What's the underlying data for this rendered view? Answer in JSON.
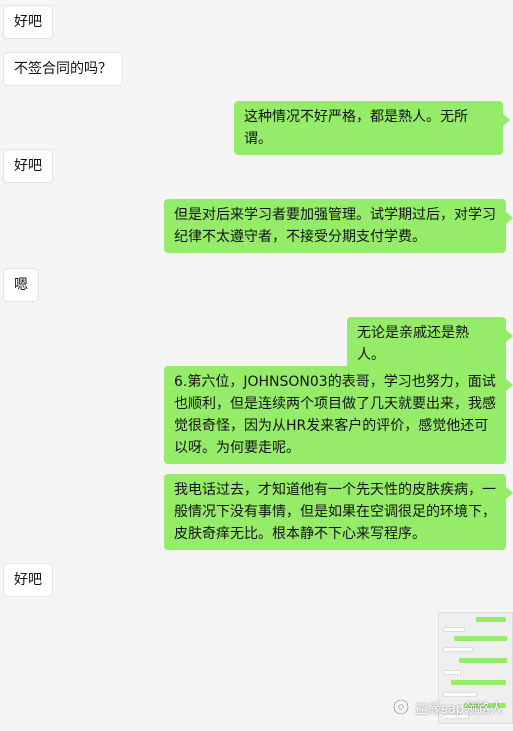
{
  "messages": [
    {
      "side": "left",
      "text": "好吧"
    },
    {
      "side": "left",
      "text": "不签合同的吗？"
    },
    {
      "side": "right",
      "text": "这种情况不好严格，都是熟人。无所谓。"
    },
    {
      "side": "left",
      "text": "好吧"
    },
    {
      "side": "right",
      "text": "但是对后来学习者要加强管理。试学期过后，对学习纪律不太遵守者，不接受分期支付学费。"
    },
    {
      "side": "left",
      "text": "嗯"
    },
    {
      "side": "right",
      "text": "无论是亲戚还是熟人。"
    },
    {
      "side": "right",
      "text": "6.第六位，JOHNSON03的表哥，学习也努力，面试也顺利，但是连续两个项目做了几天就要出来，我感觉很奇怪，因为从HR发来客户的评价，感觉他还可以呀。为何要走呢。"
    },
    {
      "side": "right",
      "text": "我电话过去，才知道他有一个先天性的皮肤疾病，一般情况下没有事情，但是如果在空调很足的环境下，皮肤奇痒无比。根本静不下心来写程序。"
    },
    {
      "side": "left",
      "text": "好吧"
    }
  ],
  "watermark": {
    "text": "益緣sap领路人",
    "icon": "wechat-official-account-icon"
  },
  "colors": {
    "right_bubble": "#95ec69",
    "left_bubble": "#ffffff",
    "background": "#f5f5f5"
  }
}
